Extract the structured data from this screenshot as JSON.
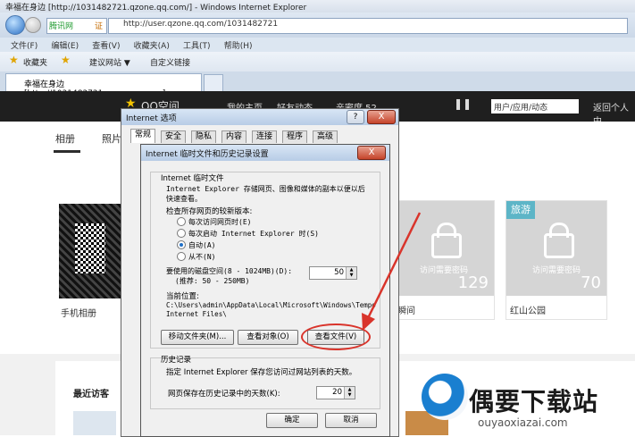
{
  "browser": {
    "title": "幸福在身边 [http://1031482721.qzone.qq.com/] - Windows Internet Explorer",
    "search_box": "腾讯网",
    "search_tag": "证",
    "url": "http://user.qzone.qq.com/1031482721",
    "menu": [
      "文件(F)",
      "编辑(E)",
      "查看(V)",
      "收藏夹(A)",
      "工具(T)",
      "帮助(H)"
    ],
    "favorites": {
      "label": "收藏夹",
      "suggested": "建议网站 ▼",
      "custom": "自定义链接"
    },
    "tab_title": "幸福在身边 [http://1031482721.qzone.qq.com]"
  },
  "qzone": {
    "logo": "QQ空间",
    "nav": [
      "我的主页",
      "好友动态",
      "亲密度 52"
    ],
    "search_placeholder": "用户/应用/动态",
    "back_text": "返回个人中",
    "tabs": [
      "相册",
      "照片"
    ],
    "albums": [
      {
        "label": "手机相册"
      },
      {
        "label": "瞬间",
        "count": "129",
        "pw_text": "访问需要密码"
      },
      {
        "label": "红山公园",
        "tag": "旅游",
        "count": "70",
        "pw_text": "访问需要密码"
      }
    ],
    "visitors_title": "最近访客"
  },
  "dialog_options": {
    "title": "Internet 选项",
    "tabs": [
      "常规",
      "安全",
      "隐私",
      "内容",
      "连接",
      "程序",
      "高级"
    ],
    "help": "?",
    "close": "X"
  },
  "dialog_temp": {
    "title": "Internet 临时文件和历史记录设置",
    "close": "X",
    "section_temp": "Internet 临时文件",
    "desc1": "Internet Explorer 存储网页、图像和媒体的副本以便以后",
    "desc2": "快速查看。",
    "check_label": "检查所存网页的较新版本:",
    "radios": [
      {
        "label": "每次访问网页时(E)",
        "selected": false
      },
      {
        "label": "每次启动 Internet Explorer 时(S)",
        "selected": false
      },
      {
        "label": "自动(A)",
        "selected": true
      },
      {
        "label": "从不(N)",
        "selected": false
      }
    ],
    "disk_label": "要使用的磁盘空间(8 - 1024MB)(D):",
    "disk_hint": "(推荐: 50 - 250MB)",
    "disk_value": "50",
    "location_label": "当前位置:",
    "location_line1": "C:\\Users\\admin\\AppData\\Local\\Microsoft\\Windows\\Tempo",
    "location_line2": "Internet Files\\",
    "btn_move": "移动文件夹(M)...",
    "btn_objects": "查看对象(O)",
    "btn_files": "查看文件(V)",
    "section_history": "历史记录",
    "history_desc": "指定 Internet Explorer 保存您访问过网站列表的天数。",
    "history_label": "网页保存在历史记录中的天数(K):",
    "history_value": "20",
    "btn_ok": "确定",
    "btn_cancel": "取消"
  },
  "watermark": {
    "text": "偶要下载站",
    "sub": "ouyaoxiazai.com"
  },
  "colors": {
    "highlight_ring": "#d9342b",
    "qq_bar": "#1f1f1f",
    "accent_blue": "#1f6fc7"
  }
}
